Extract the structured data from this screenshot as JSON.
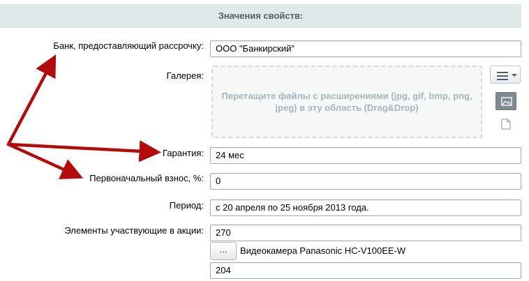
{
  "header": {
    "title": "Значения свойств:"
  },
  "properties": {
    "bank": {
      "label": "Банк, предоставляющий рассрочку:",
      "value": "ООО \"Банкирский\""
    },
    "gallery": {
      "label": "Галерея:",
      "dropzone_text": "Перетащите файлы с расширениями (jpg, gif, bmp, png, jpeg) в эту область (Drag&Drop)"
    },
    "warranty": {
      "label": "Гарантия:",
      "value": "24 мес"
    },
    "down_payment": {
      "label": "Первоначальный взнос, %:",
      "value": "0"
    },
    "period": {
      "label": "Период:",
      "value": "с 20 апреля по 25 ноября 2013 года."
    },
    "promo_items": {
      "label": "Элементы участвующие в акции:",
      "first_value": "270",
      "browse_label": "...",
      "linked_element": "Видеокамера Panasonic HC-V100EE-W",
      "second_value": "204"
    }
  },
  "icons": {
    "gallery_menu": "hamburger-menu-icon",
    "image": "image-icon",
    "file": "file-icon"
  },
  "colors": {
    "header_bg": "#e0e8ea",
    "annotation_arrow": "#b30b0b"
  }
}
